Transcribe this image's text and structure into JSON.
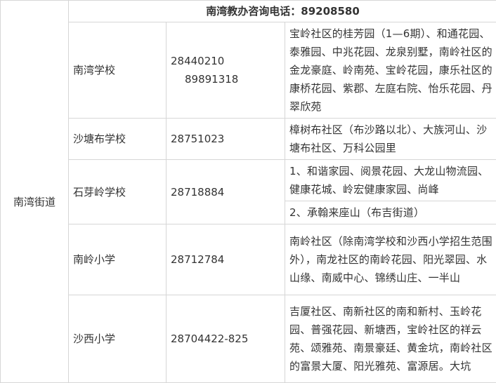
{
  "header": {
    "title": "南湾教办咨询电话：89208580"
  },
  "district": "南湾街道",
  "schools": [
    {
      "name": "南湾学校",
      "phones": [
        "28440210",
        "89891318"
      ],
      "scopes": [
        "宝岭社区的桂芳园（1—6期）、和通花园、泰雅园、中兆花园、龙泉别墅，南岭社区的金龙豪庭、岭南苑、宝岭花园，康乐社区的康桥花园、紫郡、左庭右院、怡乐花园、丹翠欣苑"
      ]
    },
    {
      "name": "沙塘布学校",
      "phones": [
        "28751023"
      ],
      "scopes": [
        "樟树布社区（布沙路以北）、大族河山、沙塘布社区、万科公园里"
      ]
    },
    {
      "name": "石芽岭学校",
      "phones": [
        "28718884"
      ],
      "scopes": [
        "1、和谐家园、阅景花园、大龙山物流园、健康花城、岭宏健康家园、尚峰",
        "2、承翰来座山（布吉街道）"
      ]
    },
    {
      "name": "南岭小学",
      "phones": [
        "28712784"
      ],
      "scopes": [
        "南岭社区（除南湾学校和沙西小学招生范围外），南龙社区的南岭花园、阳光翠园、水山缘、南威中心、锦绣山庄、一半山"
      ]
    },
    {
      "name": "沙西小学",
      "phones": [
        "28704422-825"
      ],
      "scopes": [
        "吉厦社区、南新社区的南和新村、玉岭花园、普强花园、新塘西，宝岭社区的祥云苑、颂雅苑、南景豪廷、黄金坑，南岭社区的富景大厦、阳光雅苑、富源居。大坑"
      ]
    }
  ]
}
